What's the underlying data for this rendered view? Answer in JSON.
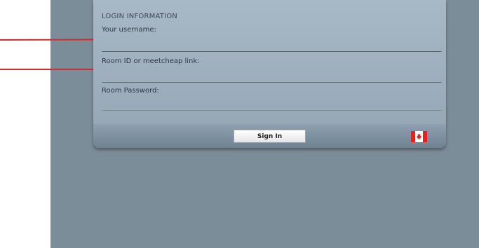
{
  "login": {
    "heading": "LOGIN INFORMATION",
    "username_label": "Your username:",
    "username_value": "",
    "room_label": "Room ID or meetcheap link:",
    "room_value": "",
    "password_label": "Room Password:",
    "password_value": "",
    "sign_in_label": "Sign In",
    "language_icon": "canada-flag-icon"
  },
  "colors": {
    "backdrop": "#7c8d9a",
    "panel": "#a7b8c7",
    "annotation": "#d12c36",
    "flag_red": "#e8211f"
  }
}
